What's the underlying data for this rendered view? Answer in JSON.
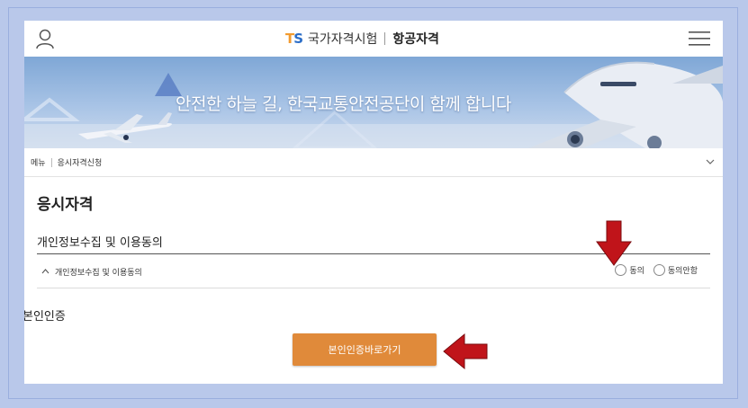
{
  "header": {
    "logo_t": "T",
    "logo_s": "S",
    "agency": "국가자격시험",
    "section": "항공자격"
  },
  "banner": {
    "slogan": "안전한 하늘 길, 한국교통안전공단이 함께 합니다"
  },
  "breadcrumb": {
    "home": "메뉴",
    "current": "응시자격신청"
  },
  "main": {
    "title": "응시자격",
    "privacy_heading": "개인정보수집 및 이용동의",
    "consent_row_label": "개인정보수집 및 이용동의",
    "agree_label": "동의",
    "disagree_label": "동의안함",
    "verify_heading": "본인인증",
    "verify_button": "본인인증바로가기"
  },
  "colors": {
    "page_bg": "#b9c8ea",
    "button": "#e08a3a",
    "annotation_arrow": "#c0141a",
    "logo_t": "#f29b2f",
    "logo_s": "#2b6dc7"
  }
}
